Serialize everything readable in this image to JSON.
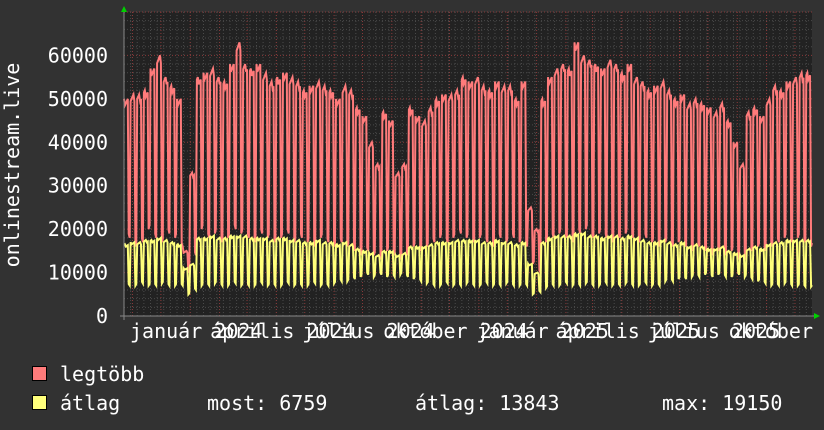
{
  "chart_data": {
    "type": "line",
    "ylabel": "onlinestream.live",
    "ylim": [
      0,
      70000
    ],
    "y_ticks": [
      "0",
      "10000",
      "20000",
      "30000",
      "40000",
      "50000",
      "60000"
    ],
    "y_tick_values": [
      0,
      10000,
      20000,
      30000,
      40000,
      50000,
      60000
    ],
    "x_range": [
      "2023-10-23",
      "2025-10-19"
    ],
    "x_tick_labels": [
      {
        "date": "2024-01-01",
        "label": "január 2024"
      },
      {
        "date": "2024-04-01",
        "label": "április 2024"
      },
      {
        "date": "2024-07-01",
        "label": "július 2024"
      },
      {
        "date": "2024-10-01",
        "label": "október 2024"
      },
      {
        "date": "2025-01-01",
        "label": "január 2025"
      },
      {
        "date": "2025-04-01",
        "label": "április 2025"
      },
      {
        "date": "2025-07-01",
        "label": "július 2025"
      },
      {
        "date": "2025-10-01",
        "label": "október 2025"
      }
    ],
    "grid": true,
    "resolution": "weekly pattern: weekday peak / weekend low per week, starting 2023-10-23",
    "series": [
      {
        "name": "legtöbb",
        "color": "#ff7b7b",
        "weekday": [
          50000,
          51000,
          51000,
          52000,
          57000,
          60000,
          55000,
          53000,
          50000,
          15000,
          33000,
          55000,
          56000,
          57000,
          55000,
          54000,
          58000,
          63000,
          58000,
          57000,
          58000,
          56000,
          54000,
          55000,
          56000,
          55000,
          54000,
          52000,
          53000,
          54000,
          53000,
          52000,
          50000,
          53000,
          52000,
          48000,
          46000,
          40000,
          35000,
          47000,
          45000,
          33000,
          35000,
          48000,
          46000,
          45000,
          48000,
          50000,
          51000,
          51000,
          52000,
          55000,
          54000,
          55000,
          53000,
          52000,
          54000,
          53000,
          53000,
          50000,
          54000,
          25000,
          20000,
          50000,
          55000,
          57000,
          58000,
          57000,
          63000,
          60000,
          59000,
          58000,
          57000,
          59000,
          58000,
          56000,
          58000,
          55000,
          54000,
          52000,
          53000,
          54000,
          52000,
          50000,
          51000,
          49000,
          50000,
          49000,
          48000,
          47000,
          49000,
          45000,
          40000,
          35000,
          47000,
          48000,
          46000,
          50000,
          53000,
          52000,
          54000,
          55000,
          56000,
          56000
        ],
        "weekend": [
          18000,
          16000,
          17000,
          20000,
          18000,
          17000,
          19000,
          18000,
          16000,
          10000,
          14000,
          20000,
          18000,
          19000,
          17000,
          18000,
          20000,
          19000,
          18000,
          17000,
          19000,
          18000,
          17000,
          18000,
          19000,
          17000,
          18000,
          17000,
          16000,
          18000,
          17000,
          16000,
          17000,
          16000,
          15000,
          14000,
          15000,
          14000,
          13000,
          15000,
          14000,
          13000,
          14000,
          16000,
          15000,
          16000,
          17000,
          18000,
          17000,
          18000,
          19000,
          18000,
          17000,
          18000,
          17000,
          16000,
          18000,
          17000,
          18000,
          17000,
          16000,
          12000,
          10000,
          17000,
          18000,
          19000,
          18000,
          17000,
          19000,
          20000,
          18000,
          19000,
          18000,
          17000,
          18000,
          19000,
          18000,
          17000,
          18000,
          17000,
          16000,
          17000,
          16000,
          17000,
          16000,
          15000,
          16000,
          15000,
          14000,
          15000,
          14000,
          15000,
          13000,
          13000,
          15000,
          16000,
          15000,
          16000,
          17000,
          18000,
          17000,
          18000,
          17000,
          16000
        ]
      },
      {
        "name": "átlag",
        "color": "#ffff7b",
        "weekday": [
          16500,
          17000,
          17000,
          17500,
          17500,
          18000,
          17500,
          17000,
          16500,
          11000,
          12000,
          18000,
          18000,
          18500,
          18000,
          18000,
          18500,
          18500,
          18500,
          18000,
          18000,
          18000,
          17500,
          18000,
          18000,
          17500,
          17500,
          17000,
          17000,
          17500,
          17000,
          17000,
          16500,
          17000,
          16500,
          15500,
          15000,
          14500,
          14000,
          15000,
          15000,
          14000,
          14500,
          16000,
          16000,
          16000,
          16500,
          17000,
          17000,
          17000,
          17500,
          17500,
          17500,
          17500,
          17000,
          17000,
          17500,
          17000,
          17000,
          16500,
          17000,
          12000,
          10000,
          17000,
          18000,
          18500,
          18500,
          18500,
          19000,
          19150,
          18500,
          18500,
          18000,
          18500,
          18500,
          18000,
          18500,
          18000,
          17500,
          17000,
          17000,
          17500,
          17000,
          16500,
          17000,
          16000,
          16500,
          16000,
          15500,
          15500,
          16000,
          15000,
          14500,
          14000,
          15500,
          16000,
          15500,
          16500,
          17000,
          17000,
          17500,
          17500,
          17500,
          17500
        ],
        "weekend": [
          7000,
          7000,
          7500,
          7000,
          7000,
          7500,
          7000,
          7000,
          7000,
          5000,
          6000,
          7000,
          7000,
          7500,
          7000,
          7000,
          7500,
          7000,
          7000,
          7000,
          7500,
          7000,
          7000,
          7000,
          7500,
          7000,
          7000,
          7000,
          7500,
          7000,
          7000,
          7500,
          8000,
          8000,
          8500,
          9000,
          9500,
          9000,
          9500,
          9000,
          9000,
          9500,
          9000,
          8500,
          8000,
          7500,
          7000,
          7000,
          7500,
          7000,
          7000,
          7500,
          7000,
          7000,
          7500,
          7000,
          7000,
          7500,
          7000,
          7000,
          7000,
          5000,
          5500,
          6500,
          7000,
          7000,
          7500,
          7000,
          7000,
          7500,
          7000,
          7000,
          7500,
          7000,
          7000,
          7500,
          7000,
          7000,
          7500,
          7000,
          7000,
          8000,
          8000,
          8500,
          8500,
          9000,
          9000,
          9500,
          9000,
          9500,
          9000,
          9000,
          9500,
          9000,
          8500,
          8000,
          7500,
          7000,
          7000,
          7500,
          7000,
          7000,
          6759,
          6759
        ]
      }
    ]
  },
  "legend": {
    "items": [
      {
        "label": "legtöbb",
        "color": "#ff7b7b"
      },
      {
        "label": "átlag",
        "color": "#ffff7b"
      }
    ],
    "now_label": "most: 6759",
    "avg_label": "átlag: 13843",
    "max_label": "max: 19150"
  },
  "colors": {
    "background": "#323232",
    "plot": "#222222",
    "grid_minor": "#555555",
    "grid_major": "#8a3a3a",
    "axis_arrow": "#00d000"
  }
}
